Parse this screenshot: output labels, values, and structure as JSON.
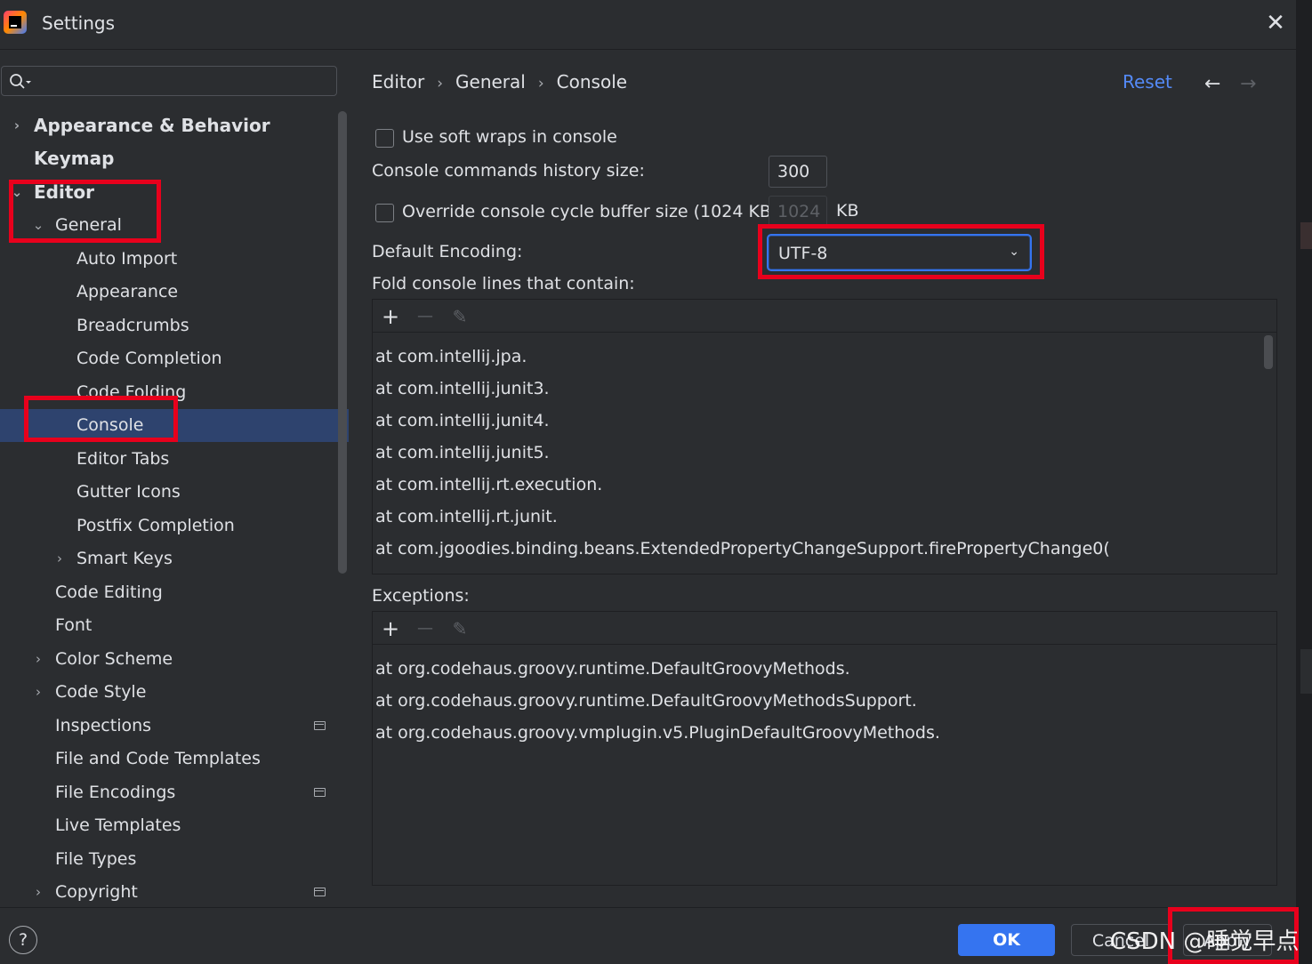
{
  "window": {
    "title": "Settings",
    "app_icon": "jetbrains-logo-icon",
    "close_icon": "close-icon"
  },
  "search": {
    "placeholder": "",
    "icon": "search-icon"
  },
  "sidebar": {
    "items": [
      {
        "label": "Appearance & Behavior",
        "chevron": "›"
      },
      {
        "label": "Keymap",
        "chevron": ""
      },
      {
        "label": "Editor",
        "chevron": "⌄"
      },
      {
        "label": "General",
        "chevron": "⌄"
      },
      {
        "label": "Auto Import",
        "chevron": ""
      },
      {
        "label": "Appearance",
        "chevron": ""
      },
      {
        "label": "Breadcrumbs",
        "chevron": ""
      },
      {
        "label": "Code Completion",
        "chevron": ""
      },
      {
        "label": "Code Folding",
        "chevron": ""
      },
      {
        "label": "Console",
        "chevron": ""
      },
      {
        "label": "Editor Tabs",
        "chevron": ""
      },
      {
        "label": "Gutter Icons",
        "chevron": ""
      },
      {
        "label": "Postfix Completion",
        "chevron": ""
      },
      {
        "label": "Smart Keys",
        "chevron": "›"
      },
      {
        "label": "Code Editing",
        "chevron": ""
      },
      {
        "label": "Font",
        "chevron": ""
      },
      {
        "label": "Color Scheme",
        "chevron": "›"
      },
      {
        "label": "Code Style",
        "chevron": "›"
      },
      {
        "label": "Inspections",
        "chevron": ""
      },
      {
        "label": "File and Code Templates",
        "chevron": ""
      },
      {
        "label": "File Encodings",
        "chevron": ""
      },
      {
        "label": "Live Templates",
        "chevron": ""
      },
      {
        "label": "File Types",
        "chevron": ""
      },
      {
        "label": "Copyright",
        "chevron": "›"
      }
    ],
    "selected": "Console"
  },
  "breadcrumb": {
    "items": [
      "Editor",
      "General",
      "Console"
    ],
    "separator": "›"
  },
  "header_actions": {
    "reset": "Reset",
    "back_icon": "←",
    "forward_icon": "→"
  },
  "console": {
    "soft_wraps_label": "Use soft wraps in console",
    "history_label": "Console commands history size:",
    "history_value": "300",
    "override_label": "Override console cycle buffer size (1024 KB)",
    "override_value": "1024",
    "override_unit": "KB",
    "encoding_label": "Default Encoding:",
    "encoding_value": "UTF-8",
    "fold_label": "Fold console lines that contain:",
    "fold_lines": [
      "at com.intellij.jpa.",
      "at com.intellij.junit3.",
      "at com.intellij.junit4.",
      "at com.intellij.junit5.",
      "at com.intellij.rt.execution.",
      "at com.intellij.rt.junit.",
      "at com.jgoodies.binding.beans.ExtendedPropertyChangeSupport.firePropertyChange0("
    ],
    "exceptions_label": "Exceptions:",
    "exceptions_lines": [
      "at org.codehaus.groovy.runtime.DefaultGroovyMethods.",
      "at org.codehaus.groovy.runtime.DefaultGroovyMethodsSupport.",
      "at org.codehaus.groovy.vmplugin.v5.PluginDefaultGroovyMethods."
    ],
    "toolbar": {
      "add": "+",
      "remove": "—",
      "edit": "✎"
    }
  },
  "footer": {
    "help": "?",
    "ok": "OK",
    "cancel": "Cancel",
    "apply": "Apply"
  },
  "watermark": "CSDN @睡觉早点",
  "colors": {
    "accent": "#3574f0",
    "link": "#548af7",
    "selection": "#2e436e",
    "highlight_box": "#e8001c",
    "background": "#2b2d30"
  }
}
